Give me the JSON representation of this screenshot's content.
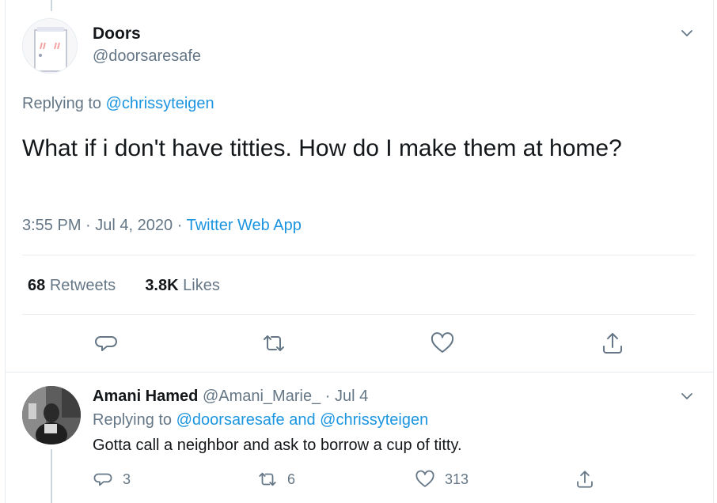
{
  "main_tweet": {
    "name": "Doors",
    "handle": "@doorsaresafe",
    "replying_prefix": "Replying to",
    "replying_to": "@chrissyteigen",
    "text": "What if i don't have titties. How do I make them at home?",
    "time": "3:55 PM",
    "date": "Jul 4, 2020",
    "source": "Twitter Web App",
    "retweets_count": "68",
    "retweets_label": "Retweets",
    "likes_count": "3.8K",
    "likes_label": "Likes"
  },
  "reply_tweet": {
    "name": "Amani Hamed",
    "handle": "@Amani_Marie_",
    "date": "Jul 4",
    "replying_prefix": "Replying to",
    "replying_to_1": "@doorsaresafe",
    "replying_and": "and",
    "replying_to_2": "@chrissyteigen",
    "text": "Gotta call a neighbor and ask to borrow a cup of titty.",
    "reply_count": "3",
    "retweet_count": "6",
    "like_count": "313"
  },
  "separator": "·",
  "colors": {
    "link": "#1b95e0",
    "secondary_text": "#657786",
    "primary_text": "#14171a",
    "divider": "#e6ecf0"
  },
  "icons": [
    "chevron-down-icon",
    "reply-icon",
    "retweet-icon",
    "like-icon",
    "share-icon"
  ]
}
